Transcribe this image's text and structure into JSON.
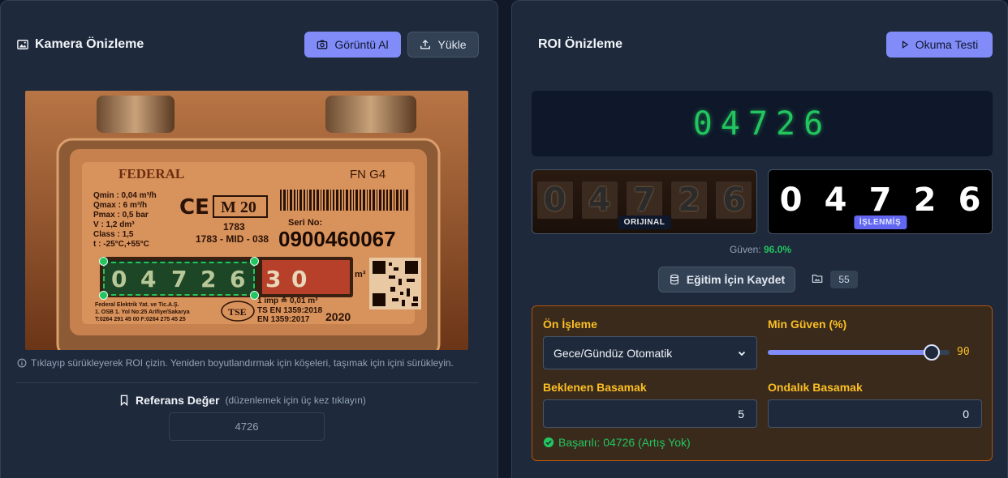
{
  "left_panel": {
    "title": "Kamera Önizleme",
    "capture_button": "Görüntü Al",
    "upload_button": "Yükle",
    "hint": "Tıklayıp sürükleyerek ROI çizin. Yeniden boyutlandırmak için köşeleri, taşımak için içini sürükleyin.",
    "reference_label": "Referans Değer",
    "reference_hint": "(düzenlemek için üç kez tıklayın)",
    "reference_value": "4726",
    "meter": {
      "brand": "FEDERAL",
      "model": "FN G4",
      "class_badge": "M 20",
      "serial_label": "Seri No:",
      "serial_number": "0900460067",
      "specs": [
        "Qmin : 0,04 m³/h",
        "Qmax : 6 m³/h",
        "Pmax : 0,5 bar",
        "V : 1,2 dm³",
        "Class : 1,5",
        "t : -25°C,+55°C"
      ],
      "code1": "1783",
      "code2": "1783 - MID - 038",
      "counter_digits": [
        "0",
        "4",
        "7",
        "2",
        "6"
      ],
      "decimal_digits": [
        "3",
        "0"
      ],
      "unit": "m³",
      "impulse": "1 imp ≙ 0,01 m³",
      "standard1": "TS EN 1359:2018",
      "standard2": "EN 1359:2017",
      "year": "2020",
      "maker_lines": [
        "Federal Elektrik Yat. ve Tic.A.Ş.",
        "1. OSB 1. Yol No:25 Arifiye/Sakarya",
        "T:0264 291 45 00 F:0264 275 45 25"
      ],
      "tse": "TSE"
    }
  },
  "right_panel": {
    "title": "ROI Önizleme",
    "test_button": "Okuma Testi",
    "reading": "04726",
    "original_digits": [
      "0",
      "4",
      "7",
      "2",
      "6"
    ],
    "processed_digits": [
      "0",
      "4",
      "7",
      "2",
      "6"
    ],
    "original_badge": "ORIJINAL",
    "processed_badge": "İŞLENMİŞ",
    "confidence_label": "Güven:",
    "confidence_value": "96.0%",
    "save_button": "Eğitim İçin Kaydet",
    "saved_count": "55",
    "settings": {
      "preprocess_label": "Ön İşleme",
      "preprocess_value": "Gece/Gündüz Otomatik",
      "min_conf_label": "Min Güven (%)",
      "min_conf_value": "90",
      "min_conf_fraction": 0.9,
      "expected_digits_label": "Beklenen Basamak",
      "expected_digits_value": "5",
      "decimal_digits_label": "Ondalık Basamak",
      "decimal_digits_value": "0",
      "status": "Başarılı: 04726 (Artış Yok)"
    }
  },
  "colors": {
    "accent": "#818cf8",
    "success": "#22c55e",
    "warning": "#fbbf24"
  }
}
